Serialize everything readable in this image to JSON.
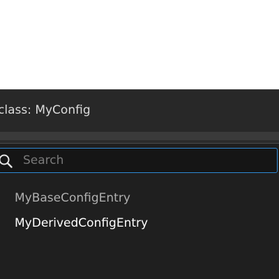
{
  "popup": {
    "title": "class: MyConfig"
  },
  "search": {
    "placeholder": "Search",
    "value": ""
  },
  "items": [
    {
      "label": "MyBaseConfigEntry"
    },
    {
      "label": "MyDerivedConfigEntry"
    }
  ],
  "colors": {
    "accent": "#2e8ad6",
    "background": "#1f1f1f",
    "header": "#282828"
  },
  "icons": {
    "search": "search-icon"
  }
}
